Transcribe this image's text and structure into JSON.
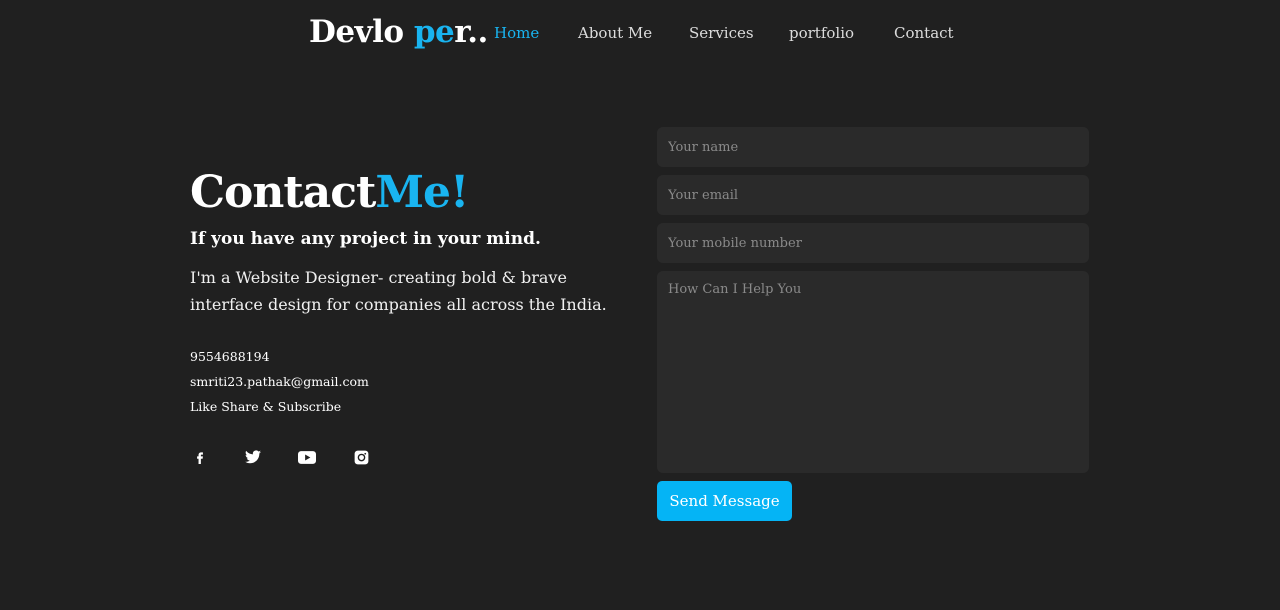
{
  "brand": {
    "part1": "Devlo ",
    "part2": "pe",
    "part3": "r.."
  },
  "nav": {
    "items": [
      {
        "label": "Home",
        "active": true
      },
      {
        "label": "About Me",
        "active": false
      },
      {
        "label": "Services",
        "active": false
      },
      {
        "label": "portfolio",
        "active": false
      },
      {
        "label": "Contact",
        "active": false
      }
    ]
  },
  "contact": {
    "title_part1": "Contact",
    "title_part2": "Me!",
    "subtitle": "If you have any project in your mind.",
    "description": "I'm a Website Designer- creating bold & brave interface design for companies all across the India.",
    "phone": "9554688194",
    "email": "smriti23.pathak@gmail.com",
    "tagline": "Like Share & Subscribe",
    "socials": [
      "facebook-icon",
      "twitter-icon",
      "youtube-icon",
      "instagram-icon"
    ]
  },
  "form": {
    "name_placeholder": "Your name",
    "email_placeholder": "Your email",
    "mobile_placeholder": "Your mobile number",
    "message_placeholder": "How Can I Help You",
    "submit_label": "Send Message"
  },
  "colors": {
    "background": "#202020",
    "accent": "#19b4f0",
    "field": "#2a2a2a",
    "button": "#05b4f5"
  }
}
